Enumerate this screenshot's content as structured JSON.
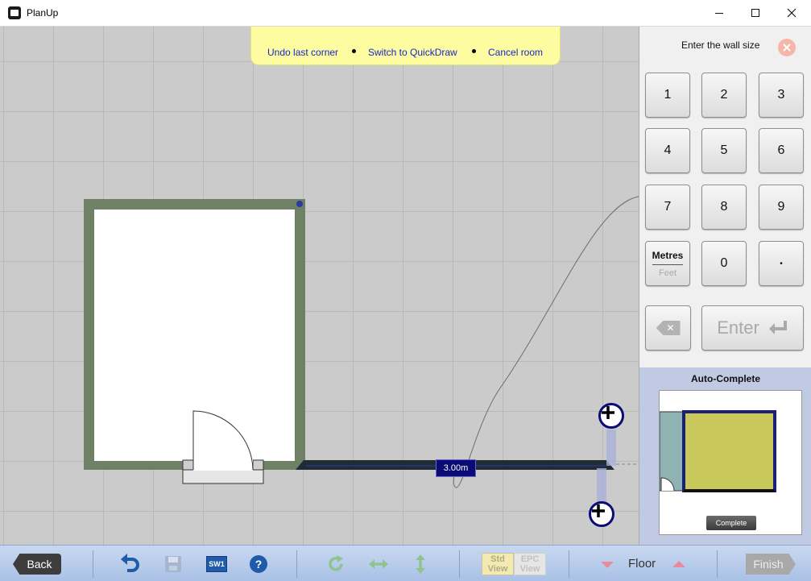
{
  "window": {
    "title": "PlanUp"
  },
  "hint_bar": {
    "undo_label": "Undo last corner",
    "quickdraw_label": "Switch to QuickDraw",
    "cancel_label": "Cancel room"
  },
  "canvas": {
    "wall_measurement": "3.00m",
    "colors": {
      "wall": "#6f8165",
      "room_fill": "#ffffff",
      "grid_bg": "#cbcbcb",
      "active_wall": "#1f2c33",
      "measurement_bg": "#0b0b75"
    }
  },
  "keypad": {
    "title": "Enter the wall size",
    "keys": [
      "1",
      "2",
      "3",
      "4",
      "5",
      "6",
      "7",
      "8",
      "9"
    ],
    "zero": "0",
    "dot": "•",
    "unit_active": "Metres",
    "unit_inactive": "Feet",
    "enter_label": "Enter"
  },
  "auto_complete": {
    "title": "Auto-Complete",
    "complete_label": "Complete",
    "colors": {
      "room_fill": "#c9c85a",
      "room_border": "#1b1f7a",
      "side_fill": "#8fb3b3"
    }
  },
  "toolbar": {
    "back_label": "Back",
    "sw1_label": "SW1",
    "help_label": "?",
    "std_view_label_1": "Std",
    "std_view_label_2": "View",
    "epc_view_label_1": "EPC",
    "epc_view_label_2": "View",
    "floor_label": "Floor",
    "finish_label": "Finish"
  }
}
